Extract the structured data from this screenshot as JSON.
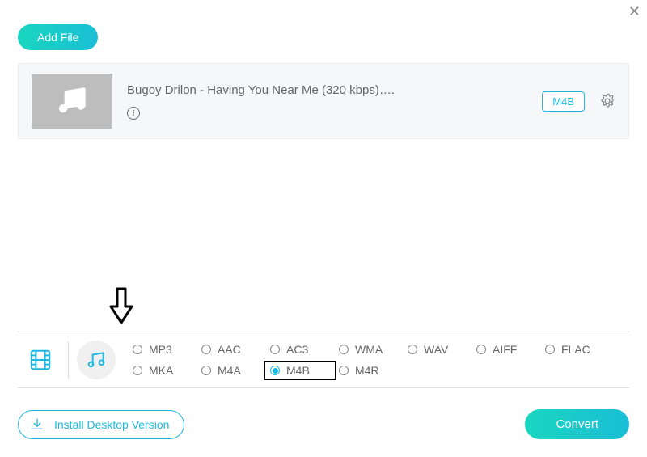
{
  "close_label": "✕",
  "toolbar": {
    "add_file_label": "Add File"
  },
  "file": {
    "title": "Bugoy Drilon - Having You Near Me (320 kbps)….",
    "format_badge": "M4B"
  },
  "formats": {
    "row1": [
      "MP3",
      "AAC",
      "AC3",
      "WMA",
      "WAV",
      "AIFF",
      "FLAC"
    ],
    "row2": [
      "MKA",
      "M4A",
      "M4B",
      "M4R"
    ],
    "selected": "M4B"
  },
  "bottom": {
    "install_label": "Install Desktop Version",
    "convert_label": "Convert"
  }
}
